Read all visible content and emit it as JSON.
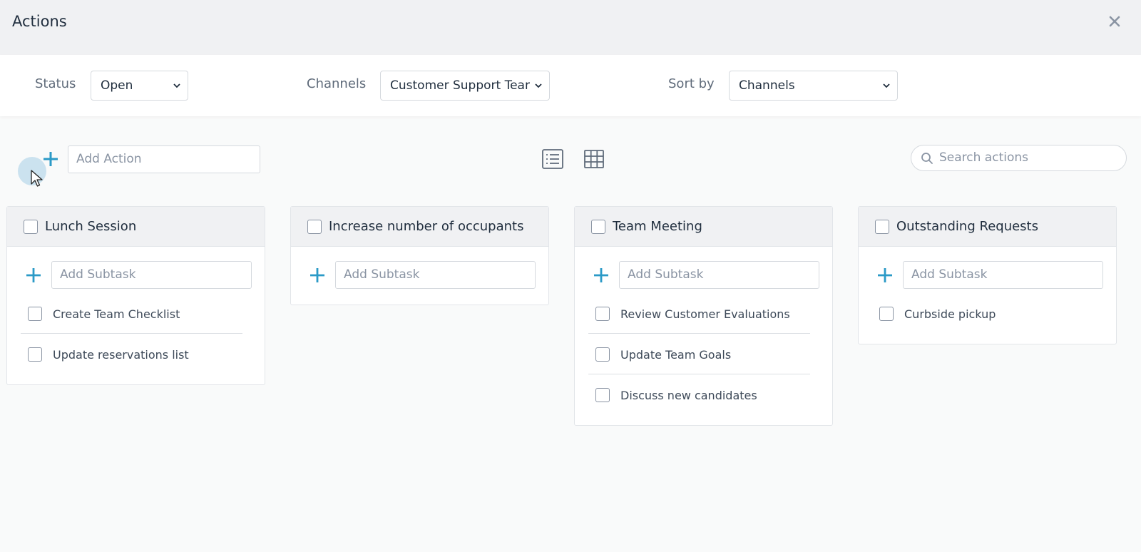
{
  "header": {
    "title": "Actions"
  },
  "filters": {
    "status": {
      "label": "Status",
      "value": "Open"
    },
    "channels": {
      "label": "Channels",
      "value": "Customer Support Tear"
    },
    "sort": {
      "label": "Sort by",
      "value": "Channels"
    }
  },
  "toolbar": {
    "add_action_placeholder": "Add Action",
    "search_placeholder": "Search actions"
  },
  "cards": [
    {
      "title": "Lunch Session",
      "add_subtask_placeholder": "Add Subtask",
      "subtasks": [
        "Create Team Checklist",
        "Update reservations list"
      ]
    },
    {
      "title": "Increase number of occupants",
      "add_subtask_placeholder": "Add Subtask",
      "subtasks": []
    },
    {
      "title": "Team Meeting",
      "add_subtask_placeholder": "Add Subtask",
      "subtasks": [
        "Review Customer Evaluations",
        "Update Team Goals",
        "Discuss new candidates"
      ]
    },
    {
      "title": "Outstanding Requests",
      "add_subtask_placeholder": "Add Subtask",
      "subtasks": [
        "Curbside pickup"
      ]
    }
  ],
  "colors": {
    "accent": "#2b9ac7",
    "header_bg": "#f0f1f3",
    "page_bg": "#f9fafa"
  }
}
